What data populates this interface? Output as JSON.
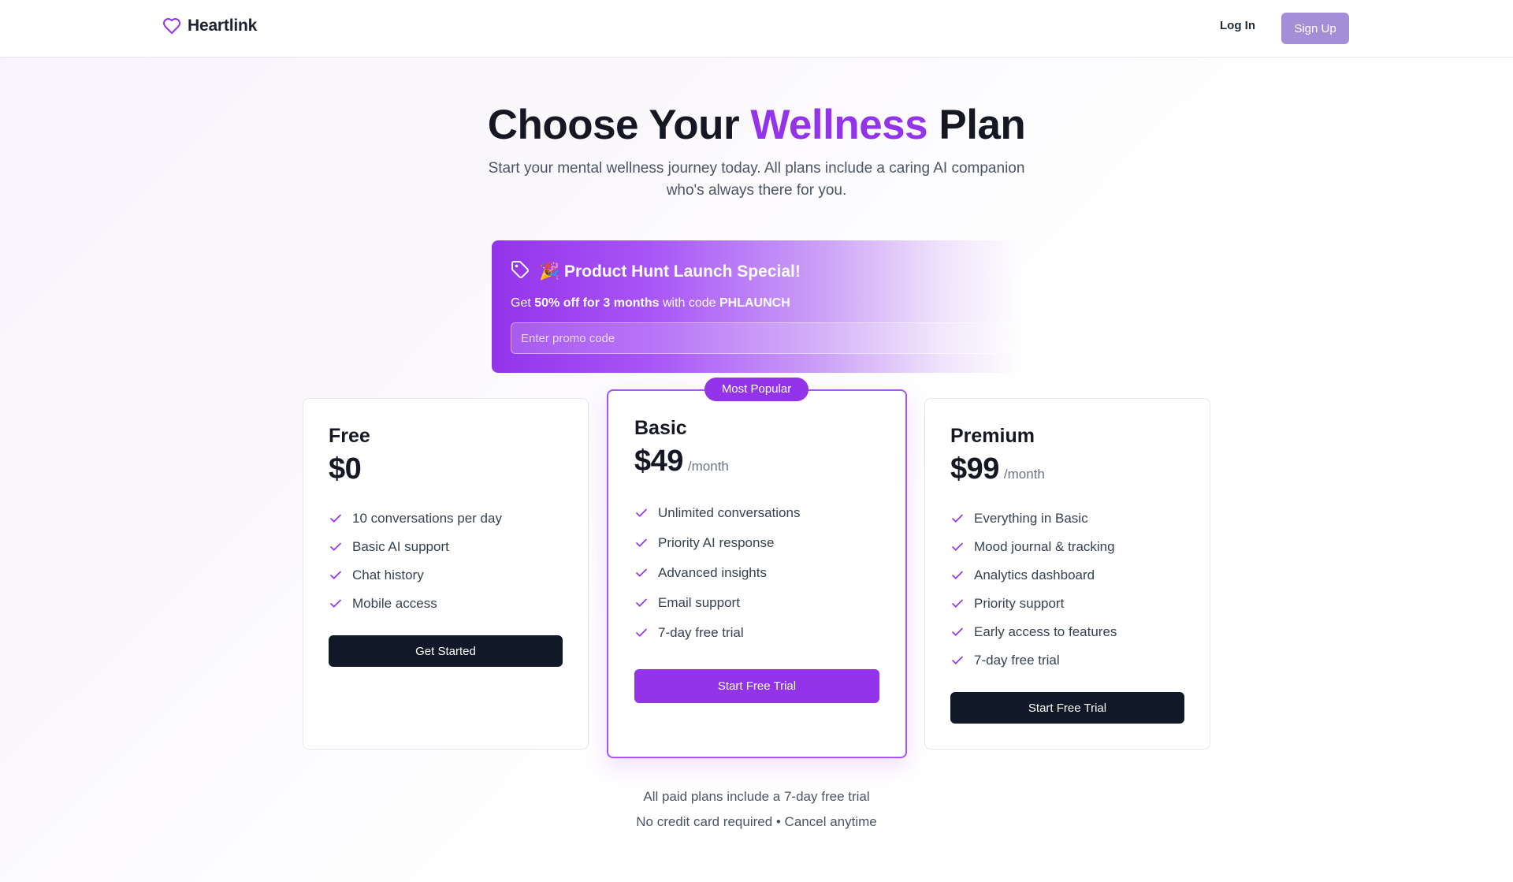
{
  "header": {
    "brand": "Heartlink",
    "login_label": "Log In",
    "signup_label": "Sign Up"
  },
  "hero": {
    "title_before": "Choose Your",
    "title_accent": "Wellness",
    "title_after": "Plan",
    "subtitle": "Start your mental wellness journey today. All plans include a caring AI companion who's always there for you."
  },
  "promo": {
    "title": "🎉 Product Hunt Launch Special!",
    "text_prefix": "Get",
    "text_offer": "50% off for 3 months",
    "text_middle": "with code",
    "code": "PHLAUNCH",
    "input_placeholder": "Enter promo code",
    "input_value": ""
  },
  "plans": {
    "free": {
      "name": "Free",
      "price": "$0",
      "features": [
        "10 conversations per day",
        "Basic AI support",
        "Chat history",
        "Mobile access"
      ],
      "cta": "Get Started"
    },
    "basic": {
      "badge": "Most Popular",
      "name": "Basic",
      "price": "$49",
      "period": "/month",
      "features": [
        "Unlimited conversations",
        "Priority AI response",
        "Advanced insights",
        "Email support",
        "7-day free trial"
      ],
      "cta": "Start Free Trial"
    },
    "premium": {
      "name": "Premium",
      "price": "$99",
      "period": "/month",
      "features": [
        "Everything in Basic",
        "Mood journal & tracking",
        "Analytics dashboard",
        "Priority support",
        "Early access to features",
        "7-day free trial"
      ],
      "cta": "Start Free Trial"
    }
  },
  "footer": {
    "note1": "All paid plans include a 7-day free trial",
    "note2": "No credit card required • Cancel anytime"
  },
  "colors": {
    "accent": "#9333ea",
    "dark_button": "#111827",
    "signup_button": "#a58ed7"
  },
  "icons": {
    "brand": "heart-icon",
    "promo": "tag-icon",
    "feature": "check-icon"
  }
}
